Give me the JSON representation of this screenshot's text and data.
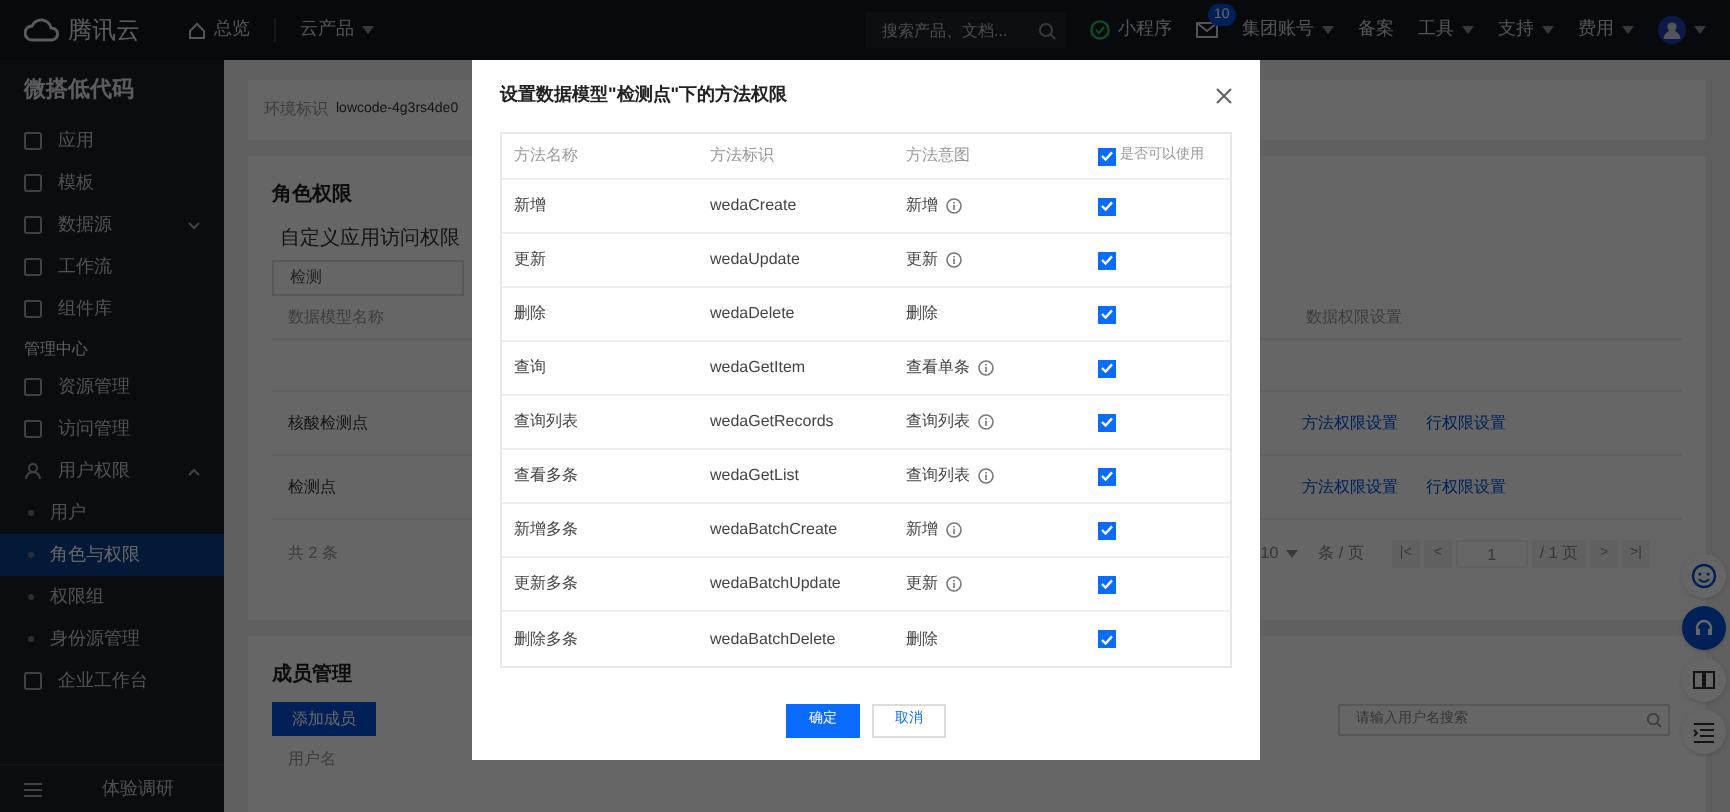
{
  "top_bar": {
    "brand": "腾讯云",
    "home": "总览",
    "products": {
      "label": "云产品",
      "has_menu": true
    },
    "search": {
      "placeholder": "搜索产品、文档..."
    },
    "mini_program": "小程序",
    "mail_badge": "10",
    "menus": [
      {
        "label": "集团账号",
        "has_menu": true
      },
      {
        "label": "备案",
        "has_menu": false
      },
      {
        "label": "工具",
        "has_menu": true
      },
      {
        "label": "支持",
        "has_menu": true
      },
      {
        "label": "费用",
        "has_menu": true
      }
    ]
  },
  "sidebar": {
    "title": "微搭低代码",
    "items": [
      {
        "kind": "item",
        "label": "应用",
        "selected": false
      },
      {
        "kind": "item",
        "label": "模板",
        "selected": false
      },
      {
        "kind": "item",
        "label": "数据源",
        "selected": false,
        "expanded": false
      },
      {
        "kind": "item",
        "label": "工作流",
        "selected": false
      },
      {
        "kind": "item",
        "label": "组件库",
        "selected": false
      },
      {
        "kind": "heading",
        "label": "管理中心"
      },
      {
        "kind": "item",
        "label": "资源管理",
        "selected": false
      },
      {
        "kind": "item",
        "label": "访问管理",
        "selected": false
      },
      {
        "kind": "item",
        "label": "用户权限",
        "selected": false,
        "expanded": true,
        "children": [
          {
            "label": "用户",
            "selected": false
          },
          {
            "label": "角色与权限",
            "selected": true
          },
          {
            "label": "权限组",
            "selected": false
          },
          {
            "label": "身份源管理",
            "selected": false
          }
        ]
      },
      {
        "kind": "item",
        "label": "企业工作台",
        "selected": false
      }
    ],
    "footer": "体验调研"
  },
  "env_card": {
    "label": "环境标识",
    "value": "lowcode-4g3rs4de0"
  },
  "roles_card": {
    "title": "角色权限",
    "tab": "自定义应用访问权限",
    "filter": "检测",
    "table": {
      "columns": [
        "数据模型名称",
        "数据权限设置"
      ],
      "rows": [
        {
          "name": "核酸检测点",
          "links": [
            "方法权限设置",
            "行权限设置"
          ]
        },
        {
          "name": "检测点",
          "links": [
            "方法权限设置",
            "行权限设置"
          ]
        }
      ]
    },
    "total": "共 2 条",
    "pagination": {
      "page_size": "10",
      "per_page": "条 / 页",
      "first": "|<",
      "prev": "<",
      "page": "1",
      "pages": "/ 1 页",
      "next": ">",
      "last": ">|"
    }
  },
  "members_card": {
    "title": "成员管理",
    "add_button": "添加成员",
    "search": {
      "placeholder": "请输入用户名搜索"
    },
    "column": "用户名"
  },
  "dialog": {
    "title": "设置数据模型\"检测点\"下的方法权限",
    "columns": [
      "方法名称",
      "方法标识",
      "方法意图",
      "是否可以使用"
    ],
    "all_allowed": true,
    "rows": [
      {
        "name": "新增",
        "id": "wedaCreate",
        "intent": "新增",
        "info": true,
        "allowed": true
      },
      {
        "name": "更新",
        "id": "wedaUpdate",
        "intent": "更新",
        "info": true,
        "allowed": true
      },
      {
        "name": "删除",
        "id": "wedaDelete",
        "intent": "删除",
        "info": false,
        "allowed": true
      },
      {
        "name": "查询",
        "id": "wedaGetItem",
        "intent": "查看单条",
        "info": true,
        "allowed": true
      },
      {
        "name": "查询列表",
        "id": "wedaGetRecords",
        "intent": "查询列表",
        "info": true,
        "allowed": true
      },
      {
        "name": "查看多条",
        "id": "wedaGetList",
        "intent": "查询列表",
        "info": true,
        "allowed": true
      },
      {
        "name": "新增多条",
        "id": "wedaBatchCreate",
        "intent": "新增",
        "info": true,
        "allowed": true
      },
      {
        "name": "更新多条",
        "id": "wedaBatchUpdate",
        "intent": "更新",
        "info": true,
        "allowed": true
      },
      {
        "name": "删除多条",
        "id": "wedaBatchDelete",
        "intent": "删除",
        "info": false,
        "allowed": true
      }
    ],
    "ok": "确定",
    "cancel": "取消"
  }
}
